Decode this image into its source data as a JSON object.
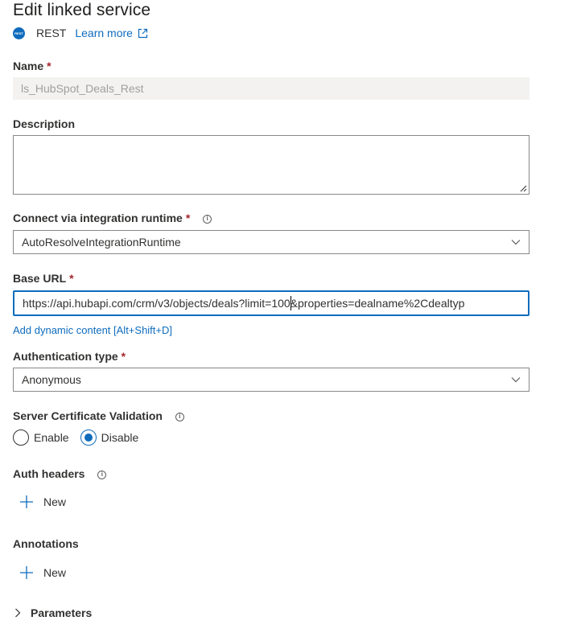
{
  "header": {
    "title": "Edit linked service",
    "connector_icon_text": "REST",
    "connector_name": "REST",
    "learn_more": "Learn more"
  },
  "name": {
    "label": "Name",
    "required": "*",
    "value": "ls_HubSpot_Deals_Rest"
  },
  "description": {
    "label": "Description",
    "value": ""
  },
  "integration_runtime": {
    "label": "Connect via integration runtime",
    "required": "*",
    "value": "AutoResolveIntegrationRuntime"
  },
  "base_url": {
    "label": "Base URL",
    "required": "*",
    "value_before_caret": "https://api.hubapi.com/crm/v3/objects/deals?limit=100",
    "value_after_caret": "&properties=dealname%2Cdealtyp",
    "dynamic_content": "Add dynamic content [Alt+Shift+D]"
  },
  "auth_type": {
    "label": "Authentication type",
    "required": "*",
    "value": "Anonymous"
  },
  "server_cert": {
    "label": "Server Certificate Validation",
    "options": [
      {
        "label": "Enable",
        "checked": false
      },
      {
        "label": "Disable",
        "checked": true
      }
    ]
  },
  "auth_headers": {
    "label": "Auth headers",
    "new_label": "New"
  },
  "annotations": {
    "label": "Annotations",
    "new_label": "New"
  },
  "parameters": {
    "label": "Parameters"
  },
  "colors": {
    "accent": "#0f6cbd",
    "required": "#a4262c",
    "text": "#323130"
  }
}
